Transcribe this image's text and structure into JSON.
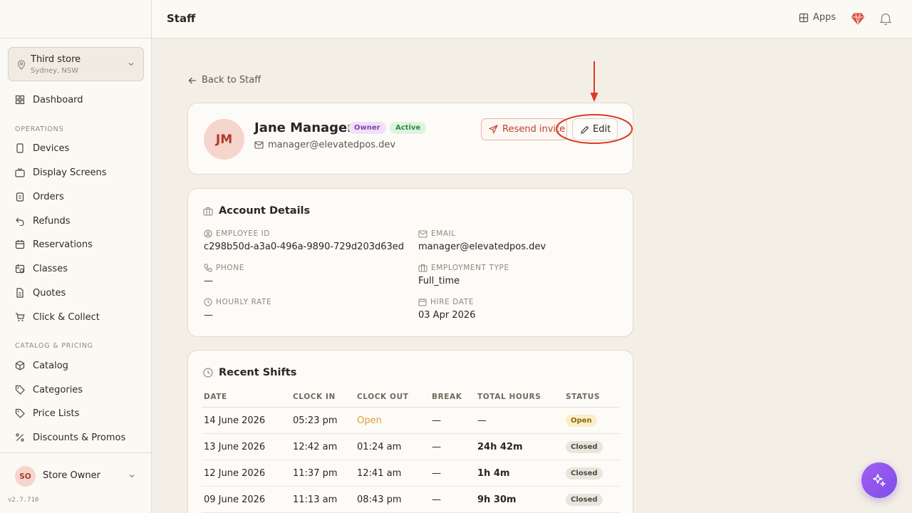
{
  "sidebar": {
    "store": {
      "name": "Third store",
      "location": "Sydney, NSW"
    },
    "dashboard": "Dashboard",
    "section_operations": "OPERATIONS",
    "operations": [
      "Devices",
      "Display Screens",
      "Orders",
      "Refunds",
      "Reservations",
      "Classes",
      "Quotes",
      "Click & Collect"
    ],
    "section_catalog": "CATALOG & PRICING",
    "catalog": [
      "Catalog",
      "Categories",
      "Price Lists",
      "Discounts & Promos"
    ],
    "user": {
      "initials": "SO",
      "name": "Store Owner"
    },
    "version": "v2.7.710"
  },
  "topbar": {
    "title": "Staff",
    "apps_label": "Apps"
  },
  "back_link": "Back to Staff",
  "profile": {
    "initials": "JM",
    "name": "Jane Manager",
    "role_badge": "Owner",
    "status_badge": "Active",
    "email": "manager@elevatedpos.dev",
    "resend_label": "Resend invite",
    "edit_label": "Edit"
  },
  "account": {
    "title": "Account Details",
    "employee_id_label": "EMPLOYEE ID",
    "employee_id": "c298b50d-a3a0-496a-9890-729d203d63ed",
    "email_label": "EMAIL",
    "email": "manager@elevatedpos.dev",
    "phone_label": "PHONE",
    "phone": "—",
    "employment_type_label": "EMPLOYMENT TYPE",
    "employment_type": "Full_time",
    "hourly_rate_label": "HOURLY RATE",
    "hourly_rate": "—",
    "hire_date_label": "HIRE DATE",
    "hire_date": "03 Apr 2026"
  },
  "shifts": {
    "title": "Recent Shifts",
    "headers": [
      "DATE",
      "CLOCK IN",
      "CLOCK OUT",
      "BREAK",
      "TOTAL HOURS",
      "STATUS"
    ],
    "rows": [
      {
        "date": "14 June 2026",
        "clock_in": "05:23 pm",
        "clock_out": "Open",
        "break": "—",
        "total": "—",
        "status": "Open"
      },
      {
        "date": "13 June 2026",
        "clock_in": "12:42 am",
        "clock_out": "01:24 am",
        "break": "—",
        "total": "24h 42m",
        "status": "Closed"
      },
      {
        "date": "12 June 2026",
        "clock_in": "11:37 pm",
        "clock_out": "12:41 am",
        "break": "—",
        "total": "1h 4m",
        "status": "Closed"
      },
      {
        "date": "09 June 2026",
        "clock_in": "11:13 am",
        "clock_out": "08:43 pm",
        "break": "—",
        "total": "9h 30m",
        "status": "Closed"
      }
    ]
  },
  "colors": {
    "accent": "#c0392b",
    "annotation": "#d93b25",
    "fab": "#8f55ef"
  }
}
